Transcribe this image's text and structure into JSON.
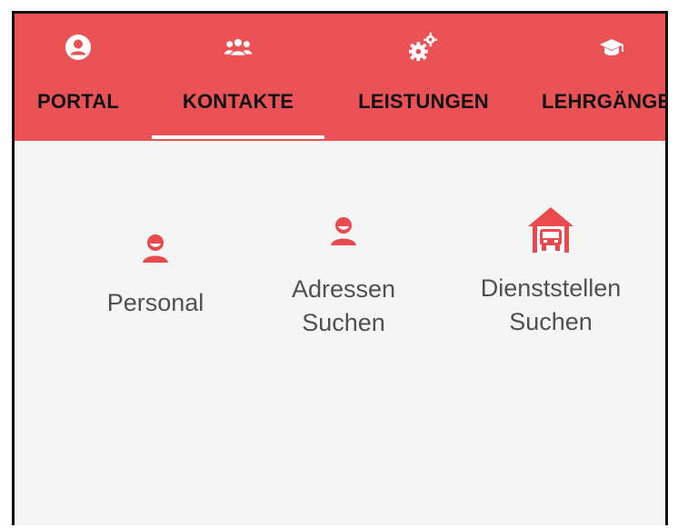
{
  "tabs": [
    {
      "label": "PORTAL",
      "icon": "user-circle-icon"
    },
    {
      "label": "KONTAKTE",
      "icon": "contacts-group-icon",
      "active": true
    },
    {
      "label": "LEISTUNGEN",
      "icon": "gears-icon"
    },
    {
      "label": "LEHRGÄNGE",
      "icon": "graduation-cap-icon"
    }
  ],
  "tiles": [
    {
      "label": "Personal",
      "icon": "person-icon"
    },
    {
      "label": "Adressen\nSuchen",
      "icon": "person-icon"
    },
    {
      "label": "Dienststellen\nSuchen",
      "icon": "fire-station-icon"
    }
  ],
  "colors": {
    "tabbar_background": "#ea5255",
    "accent": "#e84a4e",
    "content_background": "#f5f5f5",
    "tab_text": "#111111",
    "tile_text": "#505050",
    "active_indicator": "#ffffff"
  }
}
